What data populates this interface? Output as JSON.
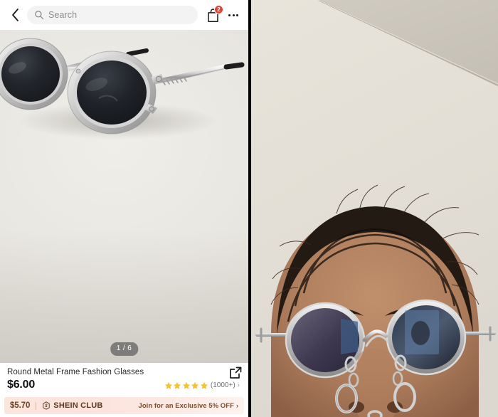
{
  "app": {
    "navbar": {
      "back_icon": "chevron-left-icon",
      "search_placeholder": "Search",
      "search_icon": "search-icon",
      "cart_icon": "shopping-bag-icon",
      "cart_badge_count": "2",
      "more_icon": "more-options-icon"
    },
    "gallery": {
      "page_counter": "1 / 6",
      "image_alt": "round-metal-frame-sunglasses",
      "background_color": "#e9e7e1"
    },
    "product": {
      "title": "Round Metal Frame Fashion Glasses",
      "price": "$6.00",
      "rating_stars": 5,
      "rating_count": "(1000+)",
      "rating_chevron": "›",
      "share_icon": "share-external-link-icon"
    },
    "club_banner": {
      "club_price": "$5.70",
      "logo_icon": "shein-club-hexagon-icon",
      "brand": "SHEIN CLUB",
      "cta": "Join for an Exclusive 5% OFF",
      "cta_chevron": "›",
      "background_color": "#fbe6dd",
      "text_color": "#6b4326"
    }
  },
  "photo": {
    "description": "close-up-face-wearing-small-round-sunglasses",
    "wall_color": "#e4e0d7",
    "ceiling_color": "#cdc8bd",
    "skin_color": "#b07f5e",
    "hair_color": "#241a14",
    "lens_color": "#4a4458"
  },
  "colors": {
    "accent_red": "#e34234",
    "star_gold": "#f2c438",
    "divider": "#000000"
  }
}
